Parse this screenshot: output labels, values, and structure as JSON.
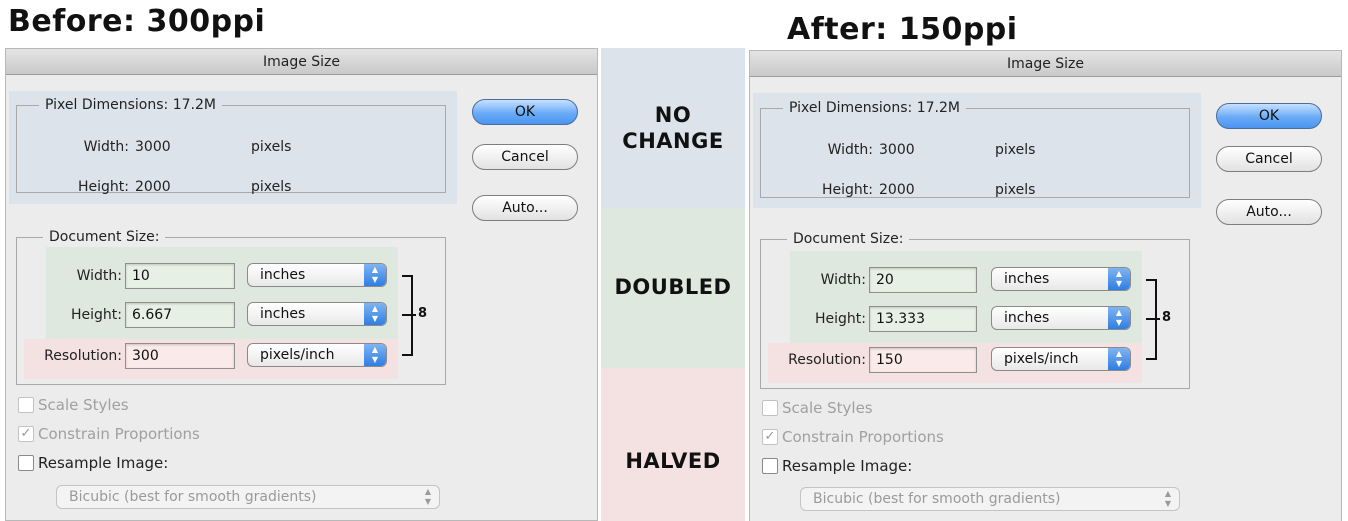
{
  "headings": {
    "before": "Before: 300ppi",
    "after": "After: 150ppi"
  },
  "comparison": {
    "pixel_dimensions": "NO CHANGE",
    "pixel_dimensions_line1": "NO",
    "pixel_dimensions_line2": "CHANGE",
    "document_size": "DOUBLED",
    "resolution": "HALVED",
    "colors": {
      "no_change": "#dde3eb",
      "doubled": "#dfe8df",
      "halved": "#f4e1e1"
    }
  },
  "dialogs": [
    {
      "title": "Image Size",
      "pixel_dimensions": {
        "legend": "Pixel Dimensions:  17.2M",
        "width_label": "Width:",
        "width_value": "3000",
        "width_unit": "pixels",
        "height_label": "Height:",
        "height_value": "2000",
        "height_unit": "pixels"
      },
      "document_size": {
        "legend": "Document Size:",
        "width_label": "Width:",
        "width_value": "10",
        "width_unit": "inches",
        "height_label": "Height:",
        "height_value": "6.667",
        "height_unit": "inches",
        "resolution_label": "Resolution:",
        "resolution_value": "300",
        "resolution_unit": "pixels/inch"
      },
      "buttons": {
        "ok": "OK",
        "cancel": "Cancel",
        "auto": "Auto..."
      },
      "options": {
        "scale_styles": {
          "label": "Scale Styles",
          "checked": false,
          "enabled": false
        },
        "constrain_proportions": {
          "label": "Constrain Proportions",
          "checked": true,
          "enabled": false
        },
        "resample_image": {
          "label": "Resample Image:",
          "checked": false,
          "enabled": true
        },
        "resample_method": "Bicubic (best for smooth gradients)"
      }
    },
    {
      "title": "Image Size",
      "pixel_dimensions": {
        "legend": "Pixel Dimensions:  17.2M",
        "width_label": "Width:",
        "width_value": "3000",
        "width_unit": "pixels",
        "height_label": "Height:",
        "height_value": "2000",
        "height_unit": "pixels"
      },
      "document_size": {
        "legend": "Document Size:",
        "width_label": "Width:",
        "width_value": "20",
        "width_unit": "inches",
        "height_label": "Height:",
        "height_value": "13.333",
        "height_unit": "inches",
        "resolution_label": "Resolution:",
        "resolution_value": "150",
        "resolution_unit": "pixels/inch"
      },
      "buttons": {
        "ok": "OK",
        "cancel": "Cancel",
        "auto": "Auto..."
      },
      "options": {
        "scale_styles": {
          "label": "Scale Styles",
          "checked": false,
          "enabled": false
        },
        "constrain_proportions": {
          "label": "Constrain Proportions",
          "checked": true,
          "enabled": false
        },
        "resample_image": {
          "label": "Resample Image:",
          "checked": false,
          "enabled": true
        },
        "resample_method": "Bicubic (best for smooth gradients)"
      }
    }
  ],
  "icons": {
    "popup_arrows": "▲▼",
    "chain_link": "link-chain-icon",
    "checkmark": "✓"
  }
}
